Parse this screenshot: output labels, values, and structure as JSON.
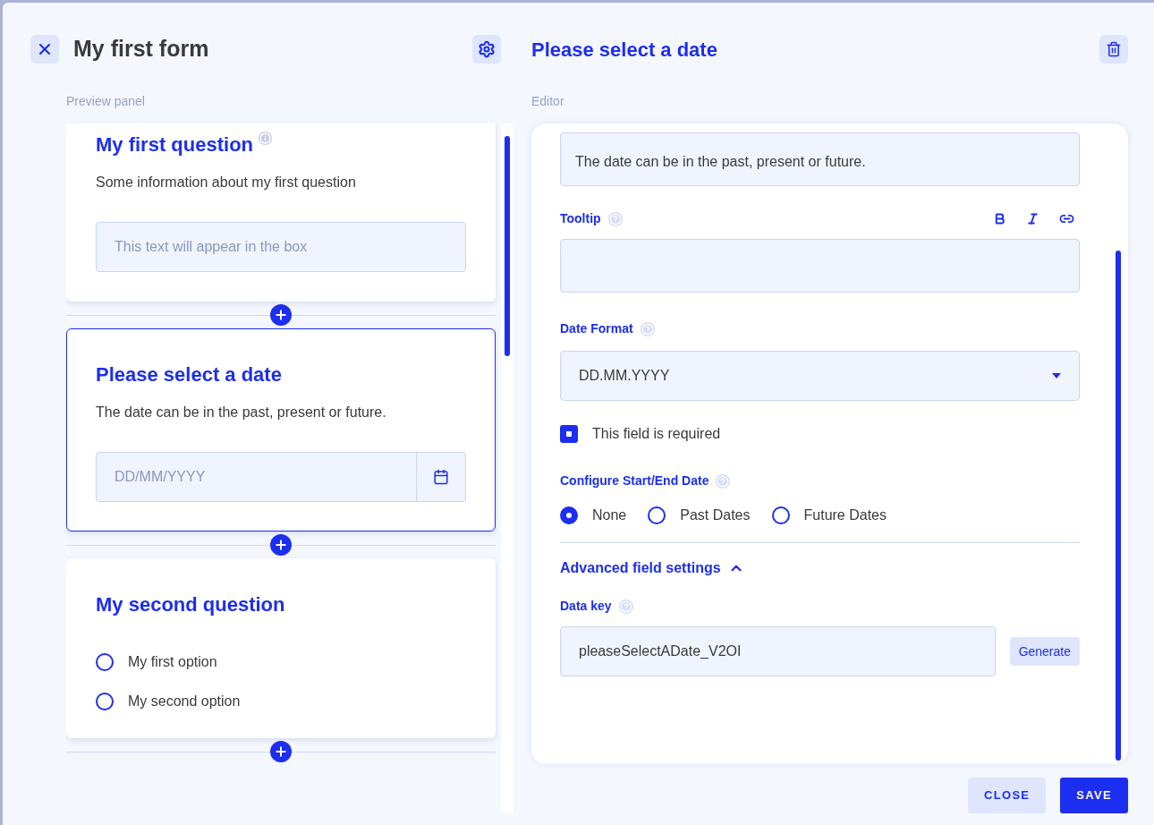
{
  "header": {
    "title": "My first form"
  },
  "preview": {
    "label": "Preview panel",
    "questions": [
      {
        "kind": "text",
        "title": "My first question",
        "has_info": true,
        "description": "Some information about my first question",
        "placeholder": "This text will appear in the box",
        "selected": false
      },
      {
        "kind": "date",
        "title": "Please select a date",
        "has_info": false,
        "description": "The date can be in the past, present or future.",
        "placeholder": "DD/MM/YYYY",
        "selected": true
      },
      {
        "kind": "radio",
        "title": "My second question",
        "has_info": false,
        "options": [
          {
            "label": "My first option",
            "selected": false
          },
          {
            "label": "My second option",
            "selected": false
          }
        ],
        "selected": false
      }
    ]
  },
  "editor": {
    "title": "Please select a date",
    "label": "Editor",
    "description_value": "The date can be in the past, present or future.",
    "tooltip": {
      "label": "Tooltip"
    },
    "date_format": {
      "label": "Date Format",
      "value": "DD.MM.YYYY"
    },
    "required": {
      "label": "This field is required",
      "checked": true
    },
    "range": {
      "label": "Configure Start/End Date",
      "options": [
        {
          "label": "None",
          "selected": true
        },
        {
          "label": "Past Dates",
          "selected": false
        },
        {
          "label": "Future Dates",
          "selected": false
        }
      ]
    },
    "advanced": {
      "label": "Advanced field settings",
      "expanded": true
    },
    "data_key": {
      "label": "Data key",
      "value": "pleaseSelectADate_V2OI",
      "button": "Generate"
    }
  },
  "footer": {
    "buttons": [
      {
        "label": "CLOSE",
        "kind": "secondary"
      },
      {
        "label": "SAVE",
        "kind": "primary"
      }
    ]
  }
}
